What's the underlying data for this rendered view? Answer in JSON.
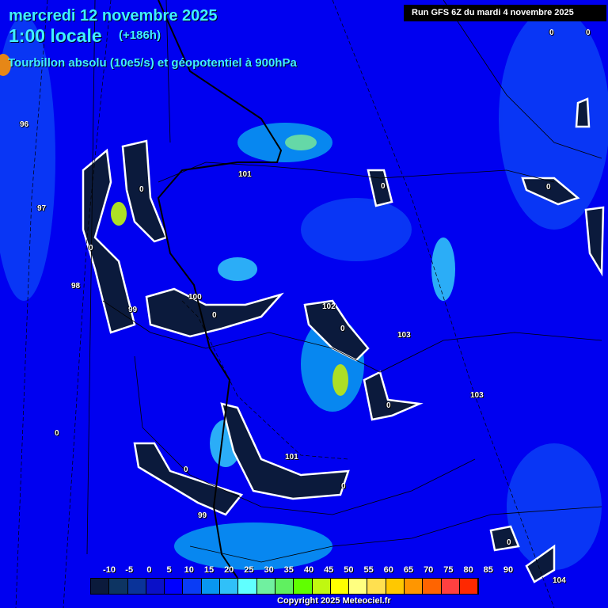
{
  "header": {
    "date": "mercredi 12 novembre 2025",
    "time": "1:00 locale",
    "lead": "(+186h)",
    "field": "Tourbillon absolu (10e5/s) et géopotentiel à 900hPa",
    "run": "Run GFS 6Z du mardi 4 novembre 2025"
  },
  "geopotential_labels": [
    "96",
    "97",
    "98",
    "99",
    "100",
    "101",
    "102",
    "103",
    "103",
    "101",
    "99",
    "104"
  ],
  "vorticity_zero_label": "0",
  "legend": {
    "ticks": [
      "-10",
      "-5",
      "0",
      "5",
      "10",
      "15",
      "20",
      "25",
      "30",
      "35",
      "40",
      "45",
      "50",
      "55",
      "60",
      "65",
      "70",
      "75",
      "80",
      "85",
      "90"
    ],
    "colors": [
      "#0b1a3c",
      "#0d3462",
      "#0a3399",
      "#0a10c8",
      "#0000ff",
      "#0a3cf5",
      "#0896f0",
      "#30c0f8",
      "#60ffff",
      "#70f0a0",
      "#60f060",
      "#60ff00",
      "#c0f810",
      "#ffff00",
      "#ffff80",
      "#ffe050",
      "#ffc800",
      "#ff9600",
      "#ff6400",
      "#ff4040",
      "#ff2800"
    ]
  },
  "copyright": "Copyright 2025 Meteociel.fr"
}
